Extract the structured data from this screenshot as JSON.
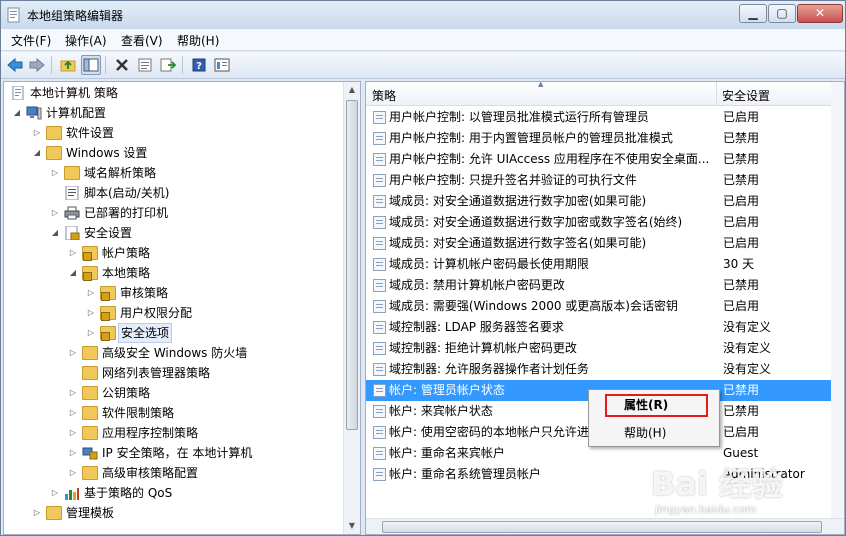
{
  "window": {
    "title": "本地组策略编辑器",
    "minimize_glyph": "▁",
    "maximize_glyph": "▢",
    "close_glyph": "✕"
  },
  "menu": [
    {
      "label": "文件(F)"
    },
    {
      "label": "操作(A)"
    },
    {
      "label": "查看(V)"
    },
    {
      "label": "帮助(H)"
    }
  ],
  "toolbar": {
    "icons": [
      "back-arrow-icon",
      "forward-arrow-icon",
      "up-folder-icon",
      "show-hide-tree-icon",
      "delete-icon",
      "properties-icon",
      "export-list-icon",
      "help-icon",
      "extended-view-icon"
    ]
  },
  "tree": [
    {
      "label": "本地计算机 策略",
      "level": 0,
      "arrow": "",
      "icon": "policy-doc-icon"
    },
    {
      "label": "计算机配置",
      "level": 1,
      "arrow": "◢",
      "icon": "computer-icon"
    },
    {
      "label": "软件设置",
      "level": 2,
      "arrow": "▷",
      "icon": "folder-icon"
    },
    {
      "label": "Windows 设置",
      "level": 2,
      "arrow": "◢",
      "icon": "folder-icon"
    },
    {
      "label": "域名解析策略",
      "level": 3,
      "arrow": "▷",
      "icon": "folder-icon"
    },
    {
      "label": "脚本(启动/关机)",
      "level": 3,
      "arrow": "",
      "icon": "script-icon"
    },
    {
      "label": "已部署的打印机",
      "level": 3,
      "arrow": "▷",
      "icon": "printer-icon"
    },
    {
      "label": "安全设置",
      "level": 3,
      "arrow": "◢",
      "icon": "security-icon"
    },
    {
      "label": "帐户策略",
      "level": 4,
      "arrow": "▷",
      "icon": "folder-lock-icon"
    },
    {
      "label": "本地策略",
      "level": 4,
      "arrow": "◢",
      "icon": "folder-lock-icon"
    },
    {
      "label": "审核策略",
      "level": 5,
      "arrow": "▷",
      "icon": "folder-lock-icon"
    },
    {
      "label": "用户权限分配",
      "level": 5,
      "arrow": "▷",
      "icon": "folder-lock-icon"
    },
    {
      "label": "安全选项",
      "level": 5,
      "arrow": "▷",
      "icon": "folder-lock-icon",
      "selected": true
    },
    {
      "label": "高级安全 Windows 防火墙",
      "level": 4,
      "arrow": "▷",
      "icon": "folder-icon"
    },
    {
      "label": "网络列表管理器策略",
      "level": 4,
      "arrow": "",
      "icon": "folder-icon"
    },
    {
      "label": "公钥策略",
      "level": 4,
      "arrow": "▷",
      "icon": "folder-icon"
    },
    {
      "label": "软件限制策略",
      "level": 4,
      "arrow": "▷",
      "icon": "folder-icon"
    },
    {
      "label": "应用程序控制策略",
      "level": 4,
      "arrow": "▷",
      "icon": "folder-icon"
    },
    {
      "label": "IP 安全策略，在 本地计算机",
      "level": 4,
      "arrow": "▷",
      "icon": "ip-security-icon"
    },
    {
      "label": "高级审核策略配置",
      "level": 4,
      "arrow": "▷",
      "icon": "folder-icon"
    },
    {
      "label": "基于策略的 QoS",
      "level": 3,
      "arrow": "▷",
      "icon": "qos-chart-icon"
    },
    {
      "label": "管理模板",
      "level": 2,
      "arrow": "▷",
      "icon": "folder-icon"
    }
  ],
  "list": {
    "col_policy": "策略",
    "col_setting": "安全设置",
    "rows": [
      {
        "name": "用户帐户控制: 以管理员批准模式运行所有管理员",
        "value": "已启用"
      },
      {
        "name": "用户帐户控制: 用于内置管理员帐户的管理员批准模式",
        "value": "已禁用"
      },
      {
        "name": "用户帐户控制: 允许 UIAccess 应用程序在不使用安全桌面...",
        "value": "已禁用"
      },
      {
        "name": "用户帐户控制: 只提升签名并验证的可执行文件",
        "value": "已禁用"
      },
      {
        "name": "域成员: 对安全通道数据进行数字加密(如果可能)",
        "value": "已启用"
      },
      {
        "name": "域成员: 对安全通道数据进行数字加密或数字签名(始终)",
        "value": "已启用"
      },
      {
        "name": "域成员: 对安全通道数据进行数字签名(如果可能)",
        "value": "已启用"
      },
      {
        "name": "域成员: 计算机帐户密码最长使用期限",
        "value": "30 天"
      },
      {
        "name": "域成员: 禁用计算机帐户密码更改",
        "value": "已禁用"
      },
      {
        "name": "域成员: 需要强(Windows 2000 或更高版本)会话密钥",
        "value": "已启用"
      },
      {
        "name": "域控制器: LDAP 服务器签名要求",
        "value": "没有定义"
      },
      {
        "name": "域控制器: 拒绝计算机帐户密码更改",
        "value": "没有定义"
      },
      {
        "name": "域控制器: 允许服务器操作者计划任务",
        "value": "没有定义"
      },
      {
        "name": "帐户: 管理员帐户状态",
        "value": "已禁用",
        "selected": true
      },
      {
        "name": "帐户: 来宾帐户状态",
        "value": "已禁用"
      },
      {
        "name": "帐户: 使用空密码的本地帐户只允许进进",
        "value": "已启用"
      },
      {
        "name": "帐户: 重命名来宾帐户",
        "value": "Guest"
      },
      {
        "name": "帐户: 重命名系统管理员帐户",
        "value": "Administrator"
      }
    ]
  },
  "context_menu": {
    "properties": "属性(R)",
    "help": "帮助(H)"
  },
  "watermark": {
    "main": "Bai 经验",
    "sub": "jingyan.baidu.com"
  }
}
